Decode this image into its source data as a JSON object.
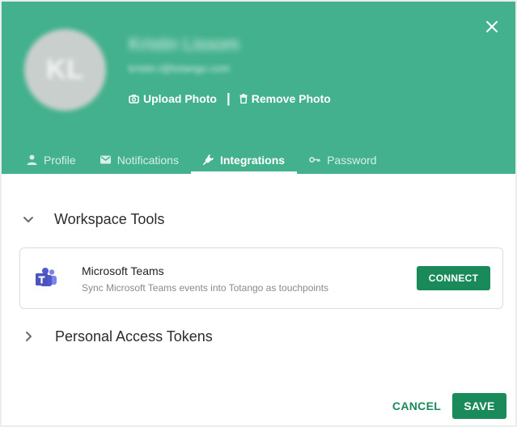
{
  "dialog": {
    "close_icon": "close-icon",
    "colors": {
      "header_bg": "#43b18d",
      "primary": "#1b8a5a",
      "card_border": "#dcdcdc"
    }
  },
  "profile": {
    "avatar_initials": "KL",
    "name": "Kristin Lissom",
    "email": "kristin.l@totango.com",
    "upload_photo_label": "Upload Photo",
    "remove_photo_label": "Remove Photo",
    "separator": "|"
  },
  "tabs": [
    {
      "label": "Profile",
      "icon": "person-icon",
      "active": false
    },
    {
      "label": "Notifications",
      "icon": "mail-icon",
      "active": false
    },
    {
      "label": "Integrations",
      "icon": "plug-icon",
      "active": true
    },
    {
      "label": "Password",
      "icon": "key-icon",
      "active": false
    }
  ],
  "sections": {
    "workspace_tools": {
      "title": "Workspace Tools",
      "expanded": true,
      "tools": [
        {
          "name": "Microsoft Teams",
          "description": "Sync Microsoft Teams events into Totango as touchpoints",
          "icon": "microsoft-teams-icon",
          "action_label": "CONNECT"
        }
      ]
    },
    "personal_access_tokens": {
      "title": "Personal Access Tokens",
      "expanded": false
    }
  },
  "footer": {
    "cancel_label": "CANCEL",
    "save_label": "SAVE"
  }
}
